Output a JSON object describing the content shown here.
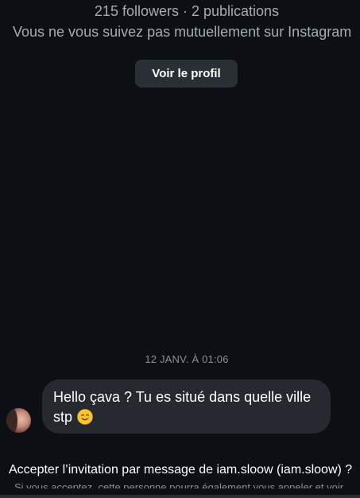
{
  "profile": {
    "stats": "215 followers · 2 publications",
    "mutual_note": "Vous ne vous suivez pas mutuellement sur Instagram",
    "view_profile_label": "Voir le profil"
  },
  "thread": {
    "timestamp": "12 JANV. À 01:06",
    "messages": [
      {
        "sender": "iam.sloow",
        "text": "Hello çava ? Tu es situé dans quelle ville stp",
        "emoji": "smiling-face-emoji"
      }
    ]
  },
  "invitation": {
    "text": "Accepter l’invitation par message de iam.sloow (iam.sloow) ?",
    "subtext": "Si vous acceptez, cette personne pourra également vous appeler et voir"
  },
  "colors": {
    "background": "#0c0f14",
    "bubble": "#262a30",
    "button": "#2a2f35",
    "muted_text": "#a7acb3"
  }
}
